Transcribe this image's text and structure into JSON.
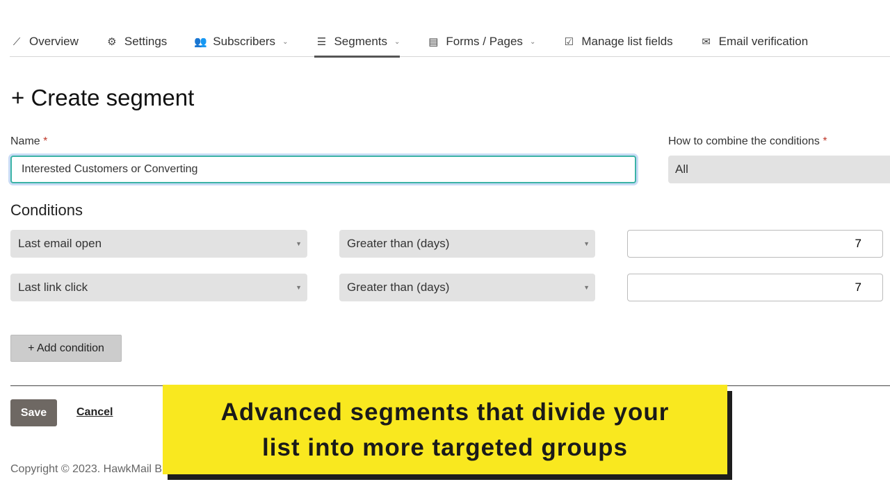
{
  "tabs": [
    {
      "label": "Overview",
      "icon": "chart-line-icon",
      "dropdown": false
    },
    {
      "label": "Settings",
      "icon": "gear-icon",
      "dropdown": false
    },
    {
      "label": "Subscribers",
      "icon": "users-icon",
      "dropdown": true
    },
    {
      "label": "Segments",
      "icon": "segments-icon",
      "dropdown": true,
      "active": true
    },
    {
      "label": "Forms / Pages",
      "icon": "form-icon",
      "dropdown": true
    },
    {
      "label": "Manage list fields",
      "icon": "checklist-icon",
      "dropdown": false
    },
    {
      "label": "Email verification",
      "icon": "mail-check-icon",
      "dropdown": false
    }
  ],
  "page": {
    "title": "Create segment"
  },
  "form": {
    "name_label": "Name",
    "required": "*",
    "name_value": "Interested Customers or Converting",
    "combine_label": "How to combine the conditions",
    "combine_value": "All",
    "conditions_title": "Conditions",
    "conditions": [
      {
        "field": "Last email open",
        "operator": "Greater than (days)",
        "value": "7"
      },
      {
        "field": "Last link click",
        "operator": "Greater than (days)",
        "value": "7"
      }
    ],
    "add_condition": "+ Add condition",
    "save": "Save",
    "cancel": "Cancel"
  },
  "footer": {
    "copyright": "Copyright © 2023. HawkMail B"
  },
  "banner": {
    "text": "Advanced segments that divide your list into more targeted groups"
  },
  "colors": {
    "accent": "#3bb3a6",
    "banner": "#f9e81f",
    "save": "#6e6863"
  }
}
